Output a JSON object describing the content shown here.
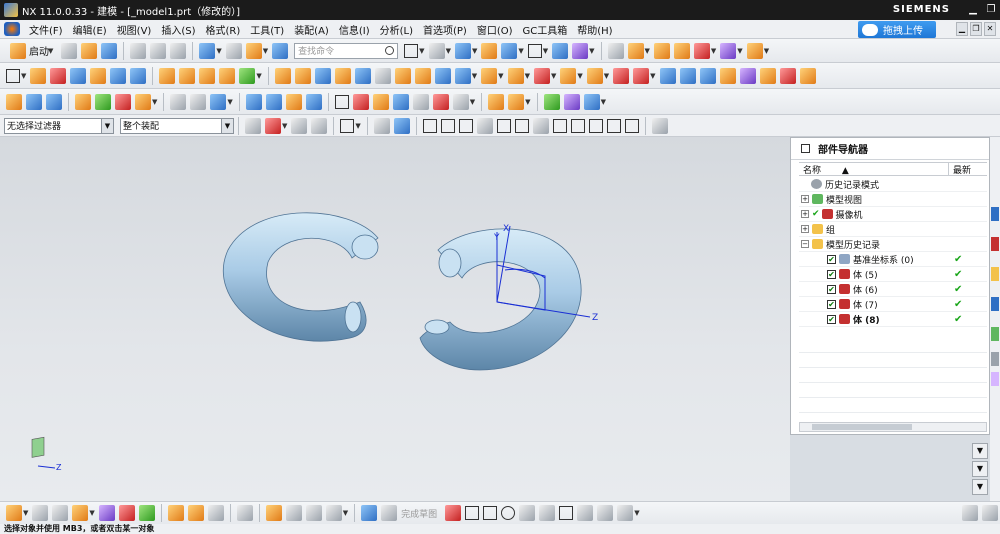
{
  "titlebar": {
    "title": "NX 11.0.0.33 - 建模 - [_model1.prt（修改的）]",
    "brand": "SIEMENS"
  },
  "menubar": {
    "items": [
      "文件(F)",
      "编辑(E)",
      "视图(V)",
      "插入(S)",
      "格式(R)",
      "工具(T)",
      "装配(A)",
      "信息(I)",
      "分析(L)",
      "首选项(P)",
      "窗口(O)",
      "GC工具箱",
      "帮助(H)"
    ],
    "cloud_button": "拖拽上传"
  },
  "toolbar1": {
    "start_label": "启动",
    "command_search_placeholder": "查找命令"
  },
  "selection_bar": {
    "filter_value": "无选择过滤器",
    "scope_value": "整个装配"
  },
  "navigator": {
    "title": "部件导航器",
    "col_name": "名称",
    "col_latest": "最新",
    "nodes": [
      {
        "label": "历史记录模式"
      },
      {
        "label": "模型视图"
      },
      {
        "label": "摄像机"
      },
      {
        "label": "组"
      },
      {
        "label": "模型历史记录"
      },
      {
        "label": "基准坐标系 (0)",
        "latest": "✔"
      },
      {
        "label": "体 (5)",
        "latest": "✔"
      },
      {
        "label": "体 (6)",
        "latest": "✔"
      },
      {
        "label": "体 (7)",
        "latest": "✔"
      },
      {
        "label": "体 (8)",
        "latest": "✔"
      }
    ]
  },
  "viewport": {
    "axis_labels": {
      "x": "X",
      "y": "Y",
      "z": "Z"
    },
    "triad_z": "Z"
  },
  "bottombar": {
    "done_sketch": "完成草图"
  },
  "status": {
    "text": "选择对象并使用 MB3，或者双击某一对象"
  },
  "colors": {
    "torus": "#a9cbe6",
    "accent": "#1e77d6",
    "check": "#1aa61a"
  }
}
